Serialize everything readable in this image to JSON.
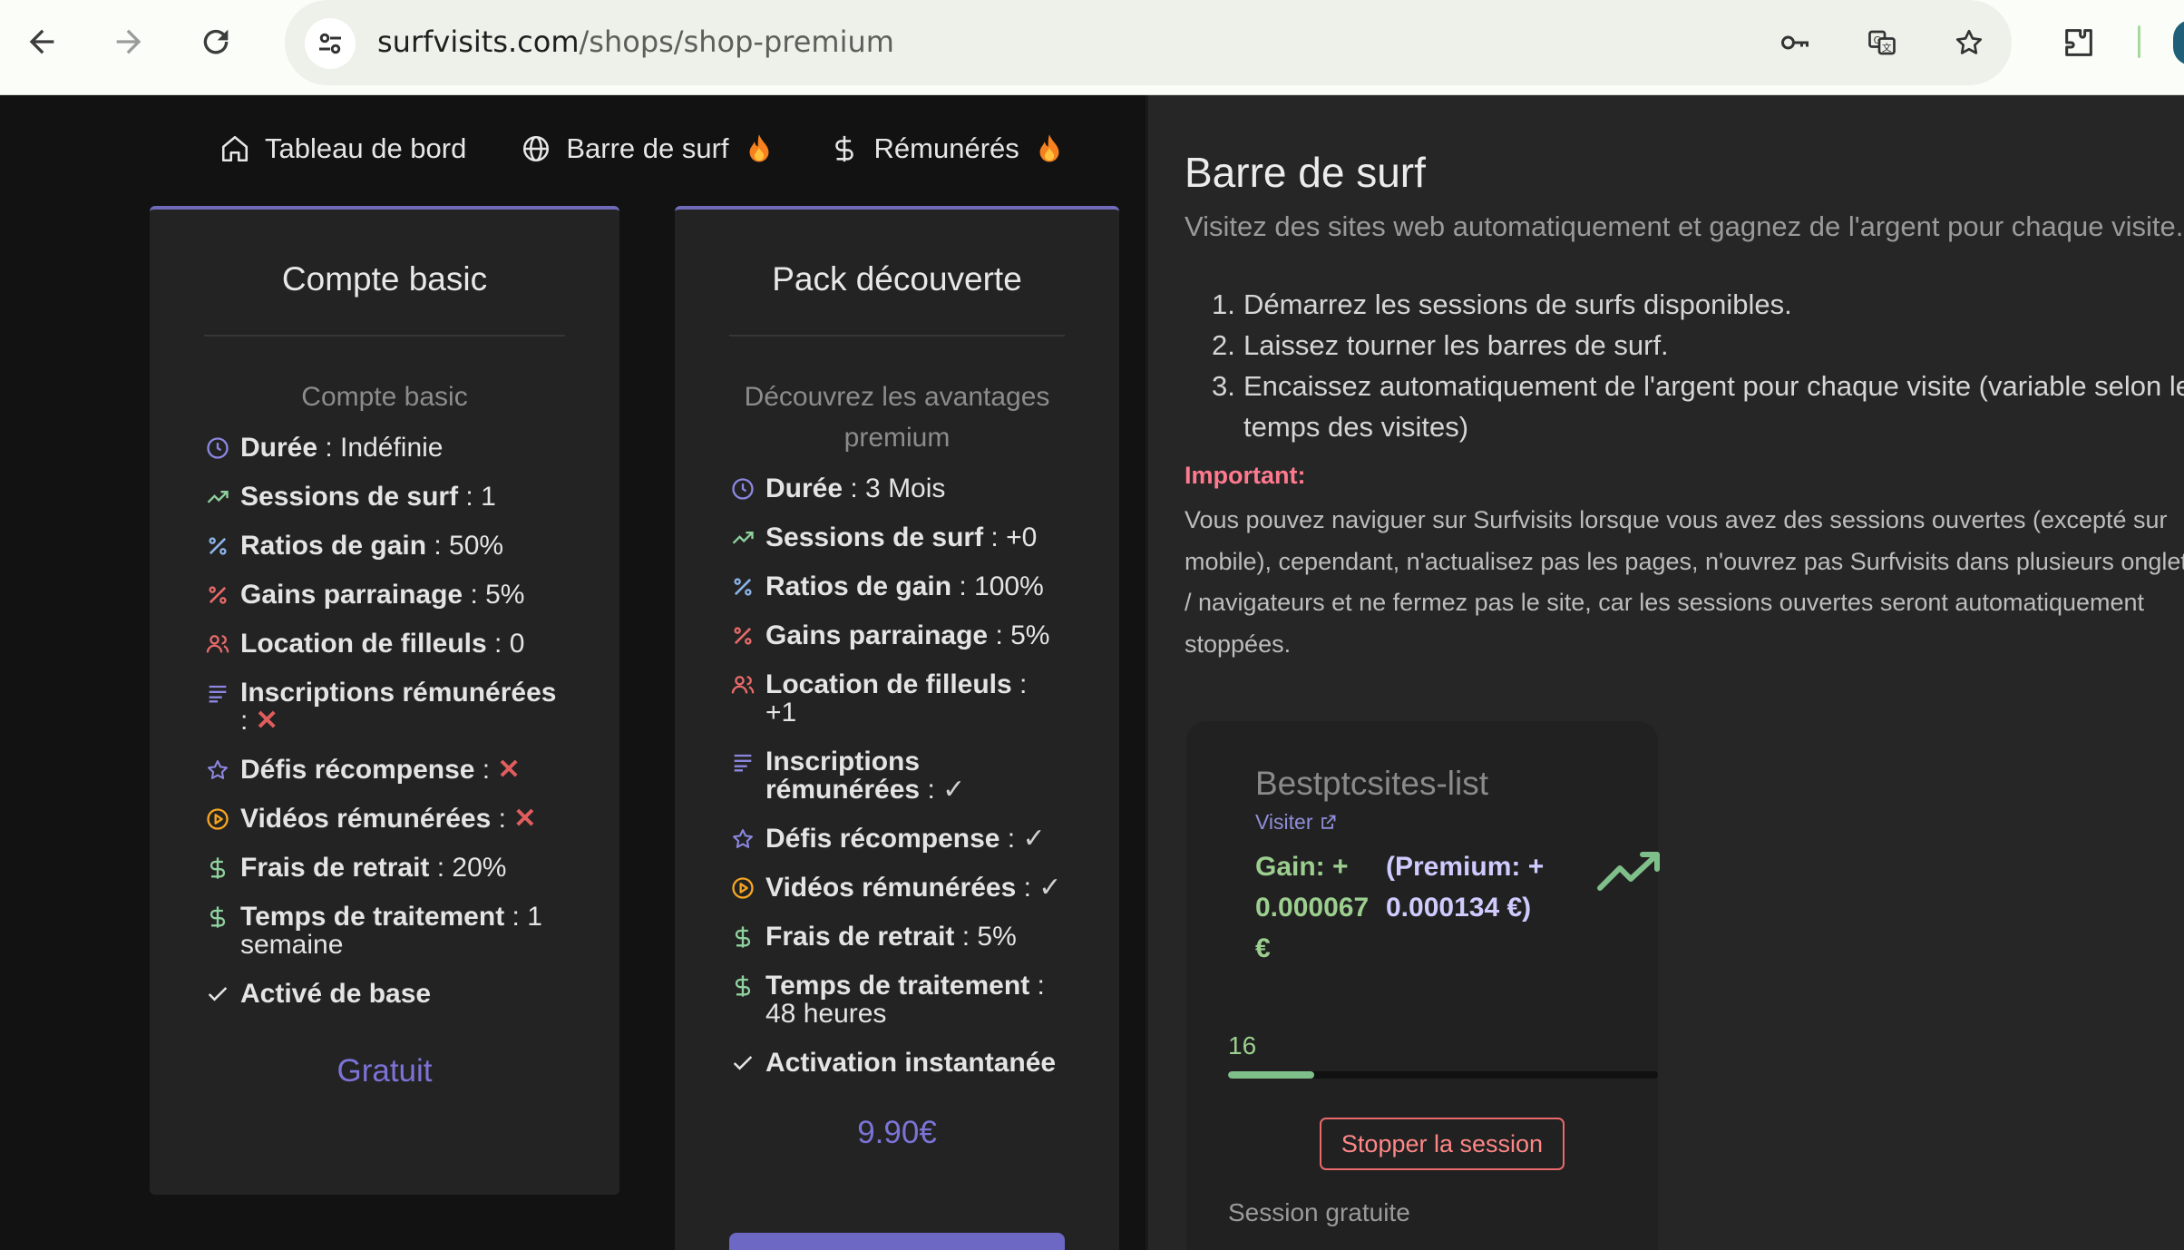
{
  "browser": {
    "url_domain": "surfvisits.com",
    "url_path": "/shops/shop-premium",
    "icons": [
      "back-icon",
      "forward-icon",
      "reload-icon",
      "tune-icon",
      "key-icon",
      "translate-icon",
      "star-icon",
      "extensions-icon"
    ]
  },
  "topnav": {
    "items": [
      {
        "label": "Tableau de bord",
        "icon": "home-icon"
      },
      {
        "label": "Barre de surf",
        "icon": "globe-icon",
        "badge": "flame-icon"
      },
      {
        "label": "Rémunérés",
        "icon": "dollar-icon",
        "badge": "flame-icon"
      }
    ]
  },
  "cards": [
    {
      "title": "Compte basic",
      "subtitle": "Compte basic",
      "features": [
        {
          "icon": "clock-icon",
          "label": "Durée",
          "value": " : Indéfinie"
        },
        {
          "icon": "trending-up-icon",
          "label": "Sessions de surf",
          "value": " : 1"
        },
        {
          "icon": "percent-icon",
          "label": "Ratios de gain",
          "value": " : 50%"
        },
        {
          "icon": "percent-icon",
          "label": "Gains parrainage",
          "value": " : 5%"
        },
        {
          "icon": "users-icon",
          "label": "Location de filleuls",
          "value": " : 0"
        },
        {
          "icon": "lines-icon",
          "label": "Inscriptions rémunérées",
          "value": " : ",
          "mark": "✕"
        },
        {
          "icon": "star-icon",
          "label": "Défis récompense",
          "value": " : ",
          "mark": "✕"
        },
        {
          "icon": "play-icon",
          "label": "Vidéos rémunérées",
          "value": " : ",
          "mark": "✕"
        },
        {
          "icon": "dollar-icon",
          "label": "Frais de retrait",
          "value": " : 20%"
        },
        {
          "icon": "dollar-icon",
          "label": "Temps de traitement",
          "value": " : 1 semaine"
        },
        {
          "icon": "check-icon",
          "label": "Activé de base",
          "value": ""
        }
      ],
      "price": "Gratuit"
    },
    {
      "title": "Pack découverte",
      "subtitle": "Découvrez les avantages premium",
      "features": [
        {
          "icon": "clock-icon",
          "label": "Durée",
          "value": " : 3 Mois"
        },
        {
          "icon": "trending-up-icon",
          "label": "Sessions de surf",
          "value": " : +0"
        },
        {
          "icon": "percent-icon",
          "label": "Ratios de gain",
          "value": " : 100%"
        },
        {
          "icon": "percent-icon",
          "label": "Gains parrainage",
          "value": " : 5%"
        },
        {
          "icon": "users-icon",
          "label": "Location de filleuls",
          "value": " : +1"
        },
        {
          "icon": "lines-icon",
          "label": "Inscriptions rémunérées",
          "value": " : ",
          "mark": "✓"
        },
        {
          "icon": "star-icon",
          "label": "Défis récompense",
          "value": " : ",
          "mark": "✓"
        },
        {
          "icon": "play-icon",
          "label": "Vidéos rémunérées",
          "value": " : ",
          "mark": "✓"
        },
        {
          "icon": "dollar-icon",
          "label": "Frais de retrait",
          "value": " : 5%"
        },
        {
          "icon": "dollar-icon",
          "label": "Temps de traitement",
          "value": " : 48 heures"
        },
        {
          "icon": "check-icon",
          "label": "Activation instantanée",
          "value": ""
        }
      ],
      "price": "9.90€"
    }
  ],
  "surfbar": {
    "title": "Barre de surf",
    "description": "Visitez des sites web automatiquement et gagnez de l'argent pour chaque visite.",
    "steps": [
      "Démarrez les sessions de surfs disponibles.",
      "Laissez tourner les barres de surf.",
      "Encaissez automatiquement de l'argent pour chaque visite (variable selon le temps des visites)"
    ],
    "important_label": "Important:",
    "important_text": "Vous pouvez naviguer sur Surfvisits lorsque vous avez des sessions ouvertes (excepté sur mobile), cependant, n'actualisez pas les pages, n'ouvrez pas Surfvisits dans plusieurs onglets / navigateurs et ne fermez pas le site, car les sessions ouvertes seront automatiquement stoppées.",
    "session": {
      "site_name": "Bestptcsites-list",
      "visit_label": "Visiter",
      "gain_text": "Gain: + 0.000067 €",
      "premium_text": "(Premium: + 0.000134 €)",
      "counter": "16",
      "progress": 0.2,
      "stop_label": "Stopper la session",
      "session_type": "Session gratuite"
    }
  },
  "colors": {
    "accent": "#6f6bb8",
    "price": "#7b73d6",
    "gain_green": "#9ccf8f",
    "important_red": "#ff7a8e",
    "stop_red": "#e86a6a"
  }
}
